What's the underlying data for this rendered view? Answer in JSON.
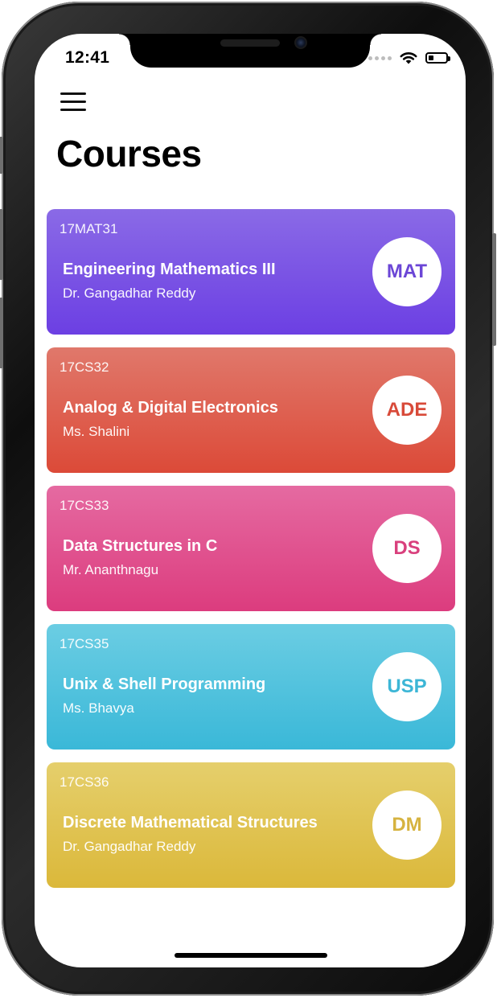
{
  "status_bar": {
    "time": "12:41",
    "wifi_icon": "wifi-icon",
    "battery_icon": "battery-icon",
    "battery_level_percent": 30
  },
  "header": {
    "menu_icon": "hamburger-menu-icon",
    "title": "Courses"
  },
  "courses": [
    {
      "code": "17MAT31",
      "name": "Engineering Mathematics III",
      "teacher": "Dr. Gangadhar Reddy",
      "badge": "MAT",
      "color_top": "#8a6ae6",
      "color_bottom": "#6c3fe3",
      "badge_color": "#6b46d6"
    },
    {
      "code": "17CS32",
      "name": "Analog & Digital Electronics",
      "teacher": "Ms. Shalini",
      "badge": "ADE",
      "color_top": "#e0786b",
      "color_bottom": "#dc4a38",
      "badge_color": "#d84a39"
    },
    {
      "code": "17CS33",
      "name": "Data Structures in C",
      "teacher": "Mr. Ananthnagu",
      "badge": "DS",
      "color_top": "#e56aa1",
      "color_bottom": "#dc3c7e",
      "badge_color": "#d9407d"
    },
    {
      "code": "17CS35",
      "name": "Unix & Shell Programming",
      "teacher": "Ms. Bhavya",
      "badge": "USP",
      "color_top": "#6bcde3",
      "color_bottom": "#3ab8d8",
      "badge_color": "#3cb6d6"
    },
    {
      "code": "17CS36",
      "name": "Discrete Mathematical Structures",
      "teacher": "Dr. Gangadhar Reddy",
      "badge": "DM",
      "color_top": "#e5cf6c",
      "color_bottom": "#dbb83a",
      "badge_color": "#d6b340"
    }
  ]
}
